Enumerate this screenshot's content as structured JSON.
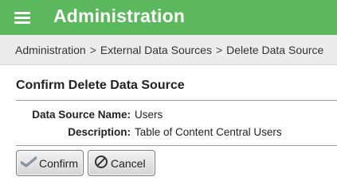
{
  "header": {
    "title": "Administration",
    "menu_icon": "hamburger-menu-icon",
    "color": "#5cb85c"
  },
  "breadcrumb": {
    "items": [
      "Administration",
      "External Data Sources",
      "Delete Data Source"
    ],
    "separator": ">"
  },
  "section": {
    "title": "Confirm Delete Data Source"
  },
  "fields": {
    "name_label": "Data Source Name:",
    "name_value": "Users",
    "description_label": "Description:",
    "description_value": "Table of Content Central Users"
  },
  "buttons": {
    "confirm_label": "Confirm",
    "confirm_icon": "checkmark-icon",
    "cancel_label": "Cancel",
    "cancel_icon": "prohibit-icon"
  }
}
